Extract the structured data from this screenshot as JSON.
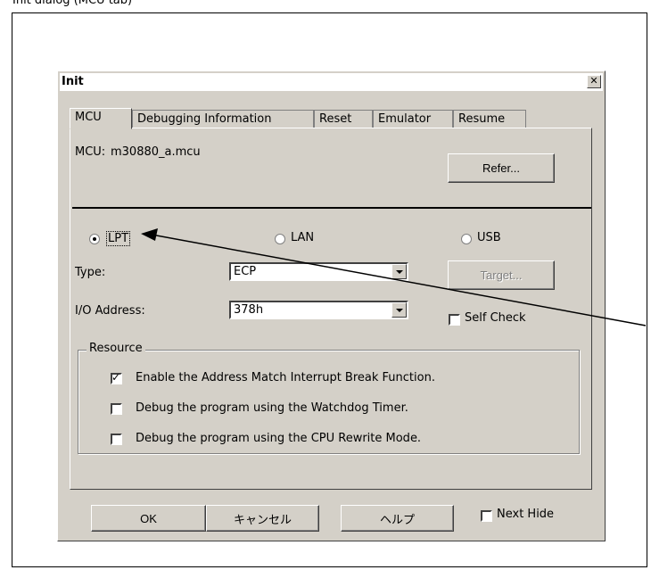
{
  "page_caption": "Init dialog (MCU tab)",
  "dialog": {
    "title": "Init",
    "close_glyph": "✕",
    "tabs": [
      "MCU",
      "Debugging Information",
      "Reset",
      "Emulator",
      "Resume"
    ],
    "active_tab": "MCU",
    "mcu_label": "MCU:",
    "mcu_value": "m30880_a.mcu",
    "refer_button": "Refer...",
    "interfaces": [
      {
        "label": "LPT",
        "selected": true
      },
      {
        "label": "LAN",
        "selected": false
      },
      {
        "label": "USB",
        "selected": false
      }
    ],
    "type_label": "Type:",
    "type_value": "ECP",
    "io_label": "I/O Address:",
    "io_value": "378h",
    "target_button": "Target...",
    "self_check_label": "Self Check",
    "self_check_checked": false,
    "resource": {
      "title": "Resource",
      "options": [
        {
          "label": "Enable the Address Match Interrupt Break Function.",
          "checked": true
        },
        {
          "label": "Debug the program using the Watchdog Timer.",
          "checked": false
        },
        {
          "label": "Debug the program using the CPU Rewrite Mode.",
          "checked": false
        }
      ]
    },
    "footer": {
      "ok": "OK",
      "cancel": "キャンセル",
      "help": "ヘルプ",
      "next_hide": "Next Hide",
      "next_hide_checked": false
    },
    "check_glyph": "✓"
  },
  "colors": {
    "dialog_bg": "#d4d0c8",
    "title_bg": "#ffffff",
    "arrow": "#000000"
  }
}
